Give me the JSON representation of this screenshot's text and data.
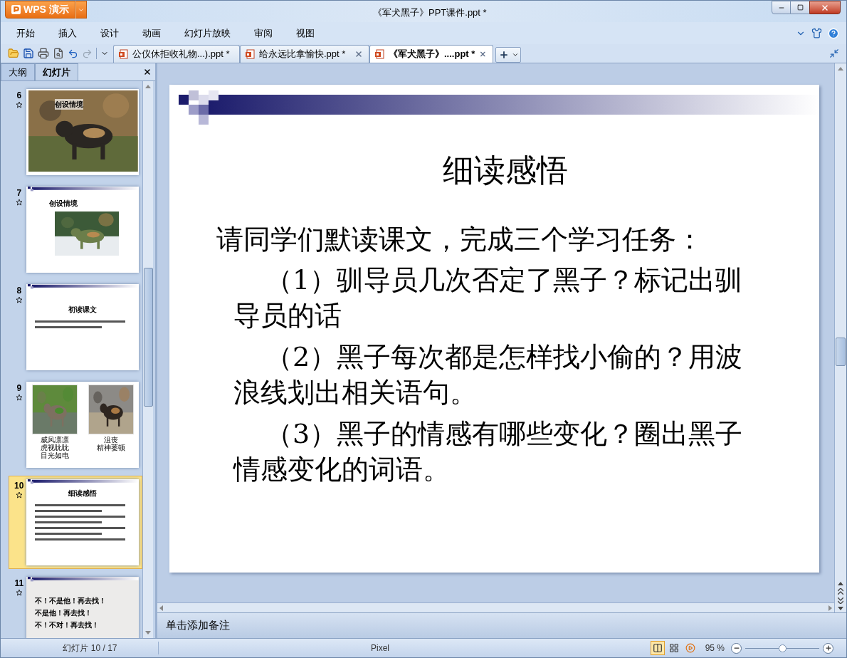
{
  "window": {
    "title": "《军犬黑子》PPT课件.ppt *"
  },
  "app_button": {
    "label": "WPS 演示"
  },
  "menu": [
    {
      "label": "开始"
    },
    {
      "label": "插入"
    },
    {
      "label": "设计"
    },
    {
      "label": "动画"
    },
    {
      "label": "幻灯片放映"
    },
    {
      "label": "审阅"
    },
    {
      "label": "视图"
    }
  ],
  "doc_tabs": [
    {
      "label": "公仪休拒收礼物...).ppt *",
      "selected": false
    },
    {
      "label": "给永远比拿愉快.ppt *",
      "selected": false
    },
    {
      "label": "《军犬黑子》....ppt *",
      "selected": true
    }
  ],
  "panel_tabs": [
    {
      "label": "大纲",
      "selected": false
    },
    {
      "label": "幻灯片",
      "selected": true
    }
  ],
  "slides": [
    {
      "number": "6",
      "selected": false,
      "kind": "picture_title",
      "title": "创设情境"
    },
    {
      "number": "7",
      "selected": false,
      "kind": "title_picture",
      "title": "创设情境"
    },
    {
      "number": "8",
      "selected": false,
      "kind": "notes",
      "title": "初读课文"
    },
    {
      "number": "9",
      "selected": false,
      "kind": "two_pictures",
      "captions": [
        [
          "威风凛凛",
          "虎视眈眈",
          "目光如电"
        ],
        [
          "沮丧",
          "精神萎顿"
        ]
      ]
    },
    {
      "number": "10",
      "selected": true,
      "kind": "tasks",
      "title": "细读感悟"
    },
    {
      "number": "11",
      "selected": false,
      "kind": "list",
      "lines": [
        "不！不是他！再去找！",
        "不是他！再去找！",
        "不！不对！再去找！"
      ]
    }
  ],
  "slide": {
    "title": "细读感悟",
    "intro": "请同学们默读课文，完成三个学习任务：",
    "tasks": [
      "（1）驯导员几次否定了黑子？标记出驯导员的话",
      "（2）黑子每次都是怎样找小偷的？用波浪线划出相关语句。",
      "（3）黑子的情感有哪些变化？圈出黑子情感变化的词语。"
    ]
  },
  "notes": {
    "placeholder": "单击添加备注"
  },
  "status_bar": {
    "slide_counter": "幻灯片 10 / 17",
    "theme": "Pixel",
    "views": [
      {
        "kind": "normal",
        "selected": true
      },
      {
        "kind": "sorter",
        "selected": false
      },
      {
        "kind": "show",
        "selected": false
      }
    ],
    "zoom": "95 %",
    "zoom_slider": {
      "level": 0.5
    }
  }
}
